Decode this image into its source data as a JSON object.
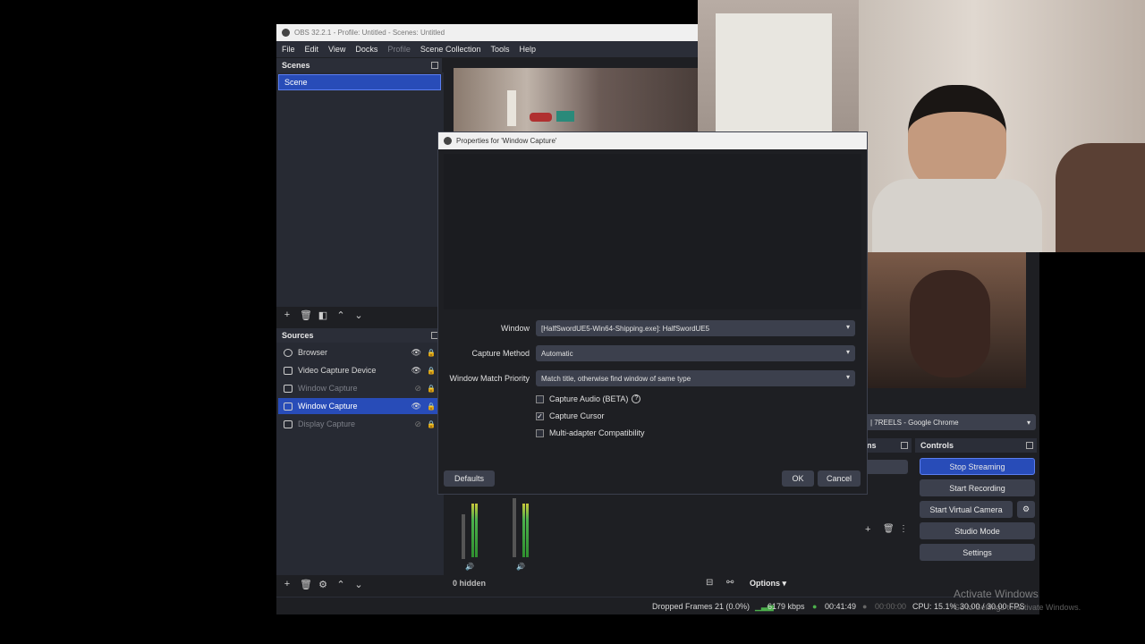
{
  "window": {
    "title": "OBS 32.2.1 - Profile: Untitled - Scenes: Untitled"
  },
  "menu": {
    "file": "File",
    "edit": "Edit",
    "view": "View",
    "docks": "Docks",
    "profile": "Profile",
    "scene_collection": "Scene Collection",
    "tools": "Tools",
    "help": "Help"
  },
  "scenes": {
    "title": "Scenes",
    "items": [
      "Scene"
    ]
  },
  "sources": {
    "title": "Sources",
    "items": [
      {
        "label": "Browser",
        "icon": "globe-icon",
        "visible": true,
        "selected": false
      },
      {
        "label": "Video Capture Device",
        "icon": "camera-icon",
        "visible": true,
        "selected": false
      },
      {
        "label": "Window Capture",
        "icon": "window-icon",
        "visible": false,
        "selected": false
      },
      {
        "label": "Window Capture",
        "icon": "window-icon",
        "visible": true,
        "selected": true
      },
      {
        "label": "Display Capture",
        "icon": "monitor-icon",
        "visible": false,
        "selected": false
      }
    ]
  },
  "dialog": {
    "title": "Properties for 'Window Capture'",
    "window_label": "Window",
    "window_value": "[HalfSwordUE5-Win64-Shipping.exe]: HalfSwordUE5",
    "capture_method_label": "Capture Method",
    "capture_method_value": "Automatic",
    "match_priority_label": "Window Match Priority",
    "match_priority_value": "Match title, otherwise find window of same type",
    "capture_audio": "Capture Audio (BETA)",
    "capture_cursor": "Capture Cursor",
    "multi_adapter": "Multi-adapter Compatibility",
    "defaults": "Defaults",
    "ok": "OK",
    "cancel": "Cancel"
  },
  "browser_source_combo": "| 7REELS - Google Chrome",
  "partial_dock_title": "ns",
  "controls": {
    "title": "Controls",
    "stop_streaming": "Stop Streaming",
    "start_recording": "Start Recording",
    "start_virtual_camera": "Start Virtual Camera",
    "studio_mode": "Studio Mode",
    "settings": "Settings"
  },
  "mixer": {
    "hidden": "0 hidden",
    "options": "Options"
  },
  "status": {
    "dropped_frames": "Dropped Frames 21 (0.0%)",
    "bitrate": "6179 kbps",
    "stream_time": "00:41:49",
    "rec_time": "00:00:00",
    "cpu": "CPU: 15.1%",
    "fps": "30.00 / 30.00 FPS"
  },
  "watermark": {
    "line1": "Activate Windows",
    "line2": "Go to Settings to activate Windows."
  },
  "colors": {
    "accent": "#284cb8",
    "bg": "#1e1f23",
    "panel": "#272a33"
  }
}
